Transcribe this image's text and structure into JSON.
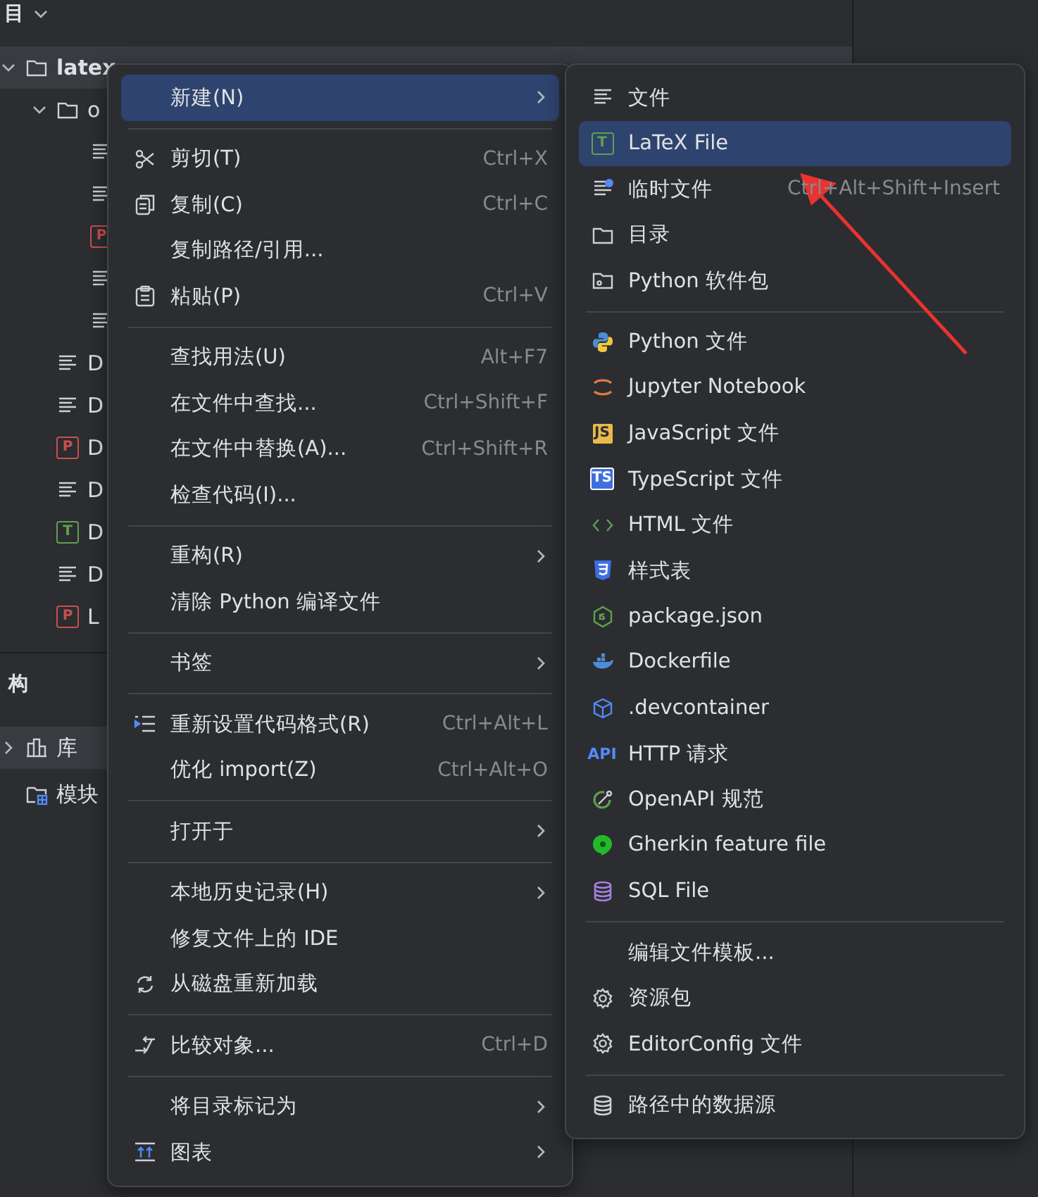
{
  "project_panel": {
    "title": "目",
    "tree": [
      {
        "label": "latex",
        "expanded": true,
        "selected": true,
        "children": [
          {
            "label": "o",
            "expanded": true,
            "children": [
              {
                "kind": "text"
              },
              {
                "kind": "text"
              },
              {
                "kind": "badge",
                "badge": "P",
                "color": "#c94f4f"
              },
              {
                "kind": "text"
              },
              {
                "kind": "text"
              }
            ]
          },
          {
            "kind": "text",
            "label": "D"
          },
          {
            "kind": "text",
            "label": "D"
          },
          {
            "kind": "badge",
            "badge": "P",
            "color": "#c94f4f",
            "label": "D"
          },
          {
            "kind": "text",
            "label": "D"
          },
          {
            "kind": "badge",
            "badge": "T",
            "color": "#5fa04e",
            "label": "D"
          },
          {
            "kind": "text",
            "label": "D"
          },
          {
            "kind": "badge",
            "badge": "P",
            "color": "#c94f4f",
            "label": "L"
          }
        ]
      }
    ]
  },
  "structure_panel": {
    "title": "构",
    "items": [
      {
        "label": "库",
        "selected": true,
        "expandable": true
      },
      {
        "label": "模块",
        "selected": false,
        "expandable": false
      }
    ]
  },
  "context_menu": [
    {
      "kind": "item",
      "label": "新建(N)",
      "submenu": true,
      "selected": true
    },
    {
      "kind": "separator"
    },
    {
      "kind": "item",
      "label": "剪切(T)",
      "shortcut": "Ctrl+X"
    },
    {
      "kind": "item",
      "label": "复制(C)",
      "shortcut": "Ctrl+C"
    },
    {
      "kind": "item",
      "label": "复制路径/引用..."
    },
    {
      "kind": "item",
      "label": "粘贴(P)",
      "shortcut": "Ctrl+V"
    },
    {
      "kind": "separator"
    },
    {
      "kind": "item",
      "label": "查找用法(U)",
      "shortcut": "Alt+F7"
    },
    {
      "kind": "item",
      "label": "在文件中查找...",
      "shortcut": "Ctrl+Shift+F"
    },
    {
      "kind": "item",
      "label": "在文件中替换(A)...",
      "shortcut": "Ctrl+Shift+R"
    },
    {
      "kind": "item",
      "label": "检查代码(I)..."
    },
    {
      "kind": "separator"
    },
    {
      "kind": "item",
      "label": "重构(R)",
      "submenu": true
    },
    {
      "kind": "item",
      "label": "清除 Python 编译文件"
    },
    {
      "kind": "separator"
    },
    {
      "kind": "item",
      "label": "书签",
      "submenu": true
    },
    {
      "kind": "separator"
    },
    {
      "kind": "item",
      "label": "重新设置代码格式(R)",
      "shortcut": "Ctrl+Alt+L"
    },
    {
      "kind": "item",
      "label": "优化 import(Z)",
      "shortcut": "Ctrl+Alt+O"
    },
    {
      "kind": "separator"
    },
    {
      "kind": "item",
      "label": "打开于",
      "submenu": true
    },
    {
      "kind": "separator"
    },
    {
      "kind": "item",
      "label": "本地历史记录(H)",
      "submenu": true
    },
    {
      "kind": "item",
      "label": "修复文件上的 IDE"
    },
    {
      "kind": "item",
      "label": "从磁盘重新加载"
    },
    {
      "kind": "separator"
    },
    {
      "kind": "item",
      "label": "比较对象...",
      "shortcut": "Ctrl+D"
    },
    {
      "kind": "separator"
    },
    {
      "kind": "item",
      "label": "将目录标记为",
      "submenu": true
    },
    {
      "kind": "item",
      "label": "图表",
      "submenu": true
    }
  ],
  "new_submenu": [
    {
      "kind": "item",
      "label": "文件"
    },
    {
      "kind": "item",
      "label": "LaTeX File",
      "badge": "T",
      "selected": true
    },
    {
      "kind": "item",
      "label": "临时文件",
      "shortcut": "Ctrl+Alt+Shift+Insert"
    },
    {
      "kind": "item",
      "label": "目录"
    },
    {
      "kind": "item",
      "label": "Python 软件包"
    },
    {
      "kind": "separator"
    },
    {
      "kind": "item",
      "label": "Python 文件"
    },
    {
      "kind": "item",
      "label": "Jupyter Notebook"
    },
    {
      "kind": "item",
      "label": "JavaScript 文件",
      "badge": "JS"
    },
    {
      "kind": "item",
      "label": "TypeScript 文件",
      "badge": "TS"
    },
    {
      "kind": "item",
      "label": "HTML 文件"
    },
    {
      "kind": "item",
      "label": "样式表"
    },
    {
      "kind": "item",
      "label": "package.json"
    },
    {
      "kind": "item",
      "label": "Dockerfile"
    },
    {
      "kind": "item",
      "label": ".devcontainer"
    },
    {
      "kind": "item",
      "label": "HTTP 请求",
      "badge": "API"
    },
    {
      "kind": "item",
      "label": "OpenAPI 规范"
    },
    {
      "kind": "item",
      "label": "Gherkin feature file"
    },
    {
      "kind": "item",
      "label": "SQL File"
    },
    {
      "kind": "separator"
    },
    {
      "kind": "item",
      "label": "编辑文件模板..."
    },
    {
      "kind": "item",
      "label": "资源包"
    },
    {
      "kind": "item",
      "label": "EditorConfig 文件"
    },
    {
      "kind": "separator"
    },
    {
      "kind": "item",
      "label": "路径中的数据源"
    }
  ]
}
